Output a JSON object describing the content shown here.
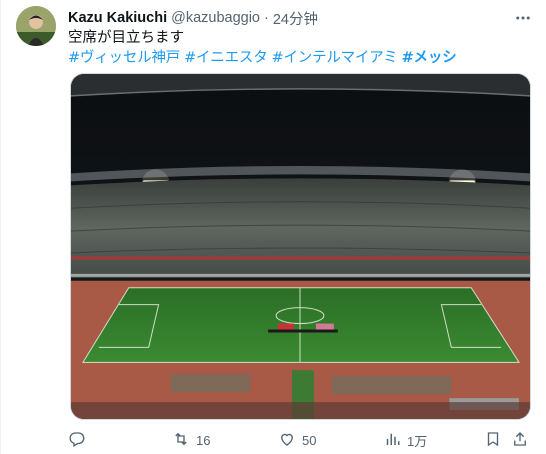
{
  "tweet": {
    "author": {
      "name": "Kazu Kakiuchi",
      "handle": "@kazubaggio",
      "separator": "·",
      "time": "24分钟"
    },
    "text": "空席が目立ちます",
    "hashtags": [
      "#ヴィッセル神戸",
      "#イニエスタ",
      "#インテルマイアミ",
      "#メッシ"
    ],
    "actions": {
      "replies": "",
      "retweets": "16",
      "likes": "50",
      "views": "1万"
    }
  },
  "colors": {
    "link": "#1d9bf0",
    "secondary_text": "#536471",
    "pitch_green": "#2f7d2a",
    "track": "#b05a45"
  },
  "icons": [
    "more-icon",
    "reply-icon",
    "retweet-icon",
    "like-icon",
    "views-icon",
    "bookmark-icon",
    "share-icon"
  ]
}
